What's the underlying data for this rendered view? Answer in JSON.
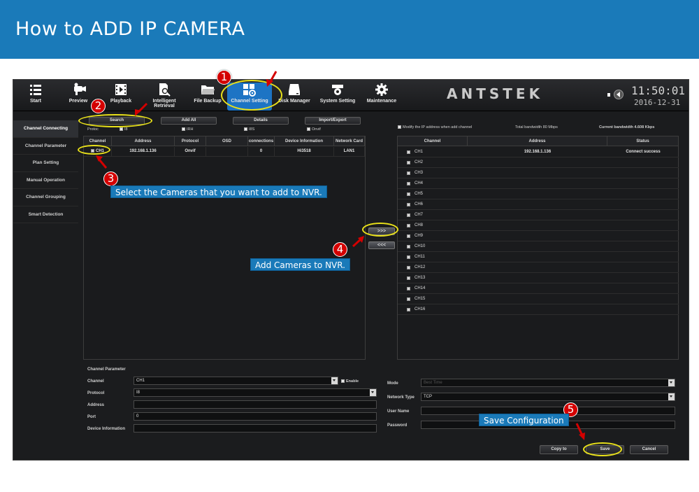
{
  "banner": {
    "title": "How to ADD IP CAMERA"
  },
  "toolbar": {
    "items": [
      {
        "label": "Start",
        "icon": "menu-icon"
      },
      {
        "label": "Preview",
        "icon": "preview-icon"
      },
      {
        "label": "Playback",
        "icon": "playback-icon"
      },
      {
        "label": "Intelligent Retrieval",
        "icon": "search-doc-icon"
      },
      {
        "label": "File Backup",
        "icon": "folder-icon"
      },
      {
        "label": "Channel Setting",
        "icon": "channel-setting-icon"
      },
      {
        "label": "Disk Manager",
        "icon": "disk-icon"
      },
      {
        "label": "System Setting",
        "icon": "system-setting-icon"
      },
      {
        "label": "Maintenance",
        "icon": "gear-icon"
      }
    ],
    "brand": "ANTSTEK",
    "time": "11:50:01",
    "date": "2016-12-31"
  },
  "sidebar": {
    "items": [
      "Channel Connecting",
      "Channel Parameter",
      "Plan Setting",
      "Manual Operation",
      "Channel Grouping",
      "Smart Detection"
    ]
  },
  "actions": {
    "search": "Search",
    "add_all": "Add All",
    "details": "Details",
    "import_export": "Import/Export"
  },
  "protocols": {
    "label": "Protoc",
    "items": [
      "I8",
      "IRH",
      "I8S",
      "Onvif"
    ]
  },
  "search_table": {
    "headers": [
      "Channel",
      "Address",
      "Protocol",
      "OSD",
      "connections",
      "Device Information",
      "Network Card"
    ],
    "rows": [
      {
        "channel": "CH1",
        "address": "192.168.1.136",
        "protocol": "Onvif",
        "osd": "",
        "connections": "0",
        "device": "Hi3518",
        "network": "LAN1"
      }
    ]
  },
  "right_panel": {
    "modify_ip_label": "Modify the IP address when add channel",
    "total_bandwidth": "Total bandwidth 80 Mbps",
    "current_bandwidth": "Current bandwidth 4.608 Kbps",
    "headers": [
      "Channel",
      "Address",
      "Status"
    ],
    "channels": [
      {
        "name": "CH1",
        "address": "192.168.1.136",
        "status": "Connect success"
      },
      {
        "name": "CH2",
        "address": "",
        "status": ""
      },
      {
        "name": "CH3",
        "address": "",
        "status": ""
      },
      {
        "name": "CH4",
        "address": "",
        "status": ""
      },
      {
        "name": "CH5",
        "address": "",
        "status": ""
      },
      {
        "name": "CH6",
        "address": "",
        "status": ""
      },
      {
        "name": "CH7",
        "address": "",
        "status": ""
      },
      {
        "name": "CH8",
        "address": "",
        "status": ""
      },
      {
        "name": "CH9",
        "address": "",
        "status": ""
      },
      {
        "name": "CH10",
        "address": "",
        "status": ""
      },
      {
        "name": "CH11",
        "address": "",
        "status": ""
      },
      {
        "name": "CH12",
        "address": "",
        "status": ""
      },
      {
        "name": "CH13",
        "address": "",
        "status": ""
      },
      {
        "name": "CH14",
        "address": "",
        "status": ""
      },
      {
        "name": "CH15",
        "address": "",
        "status": ""
      },
      {
        "name": "CH16",
        "address": "",
        "status": ""
      }
    ]
  },
  "arrows": {
    "add": ">>>",
    "remove": "<<<"
  },
  "channel_param": {
    "title": "Channel Parameter",
    "channel_label": "Channel",
    "channel_value": "CH1",
    "enable_label": "Enable",
    "protocol_label": "Protocol",
    "protocol_value": "I8",
    "address_label": "Address",
    "address_value": "",
    "port_label": "Port",
    "port_value": "0",
    "device_label": "Device Information",
    "device_value": "",
    "mode_label": "Mode",
    "mode_value": "Best Time",
    "network_type_label": "Network Type",
    "network_type_value": "TCP",
    "username_label": "User Name",
    "username_value": "",
    "password_label": "Password",
    "password_value": ""
  },
  "footer": {
    "copy_to": "Copy to",
    "save": "Save",
    "cancel": "Cancel"
  },
  "annotations": {
    "step1": "1",
    "step2": "2",
    "step3": "3",
    "step3_text": "Select the Cameras that you want to add to NVR.",
    "step4": "4",
    "step4_text": "Add Cameras to NVR.",
    "step5": "5",
    "step5_text": "Save Configuration"
  },
  "colors": {
    "banner": "#1a7ab9",
    "highlight": "#e8e01a",
    "step_badge": "#d40000",
    "active_tab": "#1d74c4"
  }
}
